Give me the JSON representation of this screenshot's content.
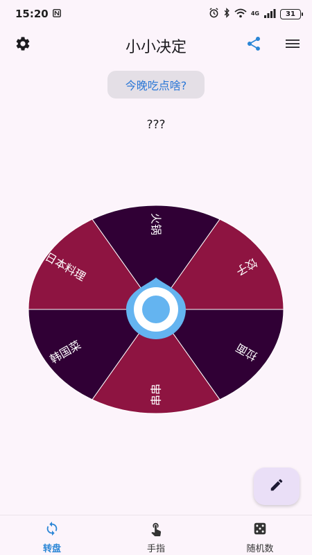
{
  "status_bar": {
    "time": "15:20",
    "network_label": "4G",
    "battery": "31"
  },
  "app_bar": {
    "title": "小小决定",
    "icons": [
      "settings-icon",
      "share-icon",
      "menu-icon"
    ]
  },
  "question": {
    "label": "今晚吃点啥?"
  },
  "result": {
    "text": "???"
  },
  "wheel": {
    "segments": [
      {
        "label": "火锅",
        "color": "#300035"
      },
      {
        "label": "饺子",
        "color": "#8e1441"
      },
      {
        "label": "拉面",
        "color": "#300035"
      },
      {
        "label": "串串",
        "color": "#8e1441"
      },
      {
        "label": "韩国菜",
        "color": "#300035"
      },
      {
        "label": "日本料理",
        "color": "#8e1441"
      }
    ],
    "pointer_color": "#64b4f0"
  },
  "fab": {
    "icon": "pencil-icon"
  },
  "bottom_nav": {
    "items": [
      {
        "label": "转盘",
        "icon": "refresh-icon",
        "active": true
      },
      {
        "label": "手指",
        "icon": "finger-tap-icon",
        "active": false
      },
      {
        "label": "随机数",
        "icon": "dice-icon",
        "active": false
      }
    ],
    "accent": "#2b86d6"
  }
}
